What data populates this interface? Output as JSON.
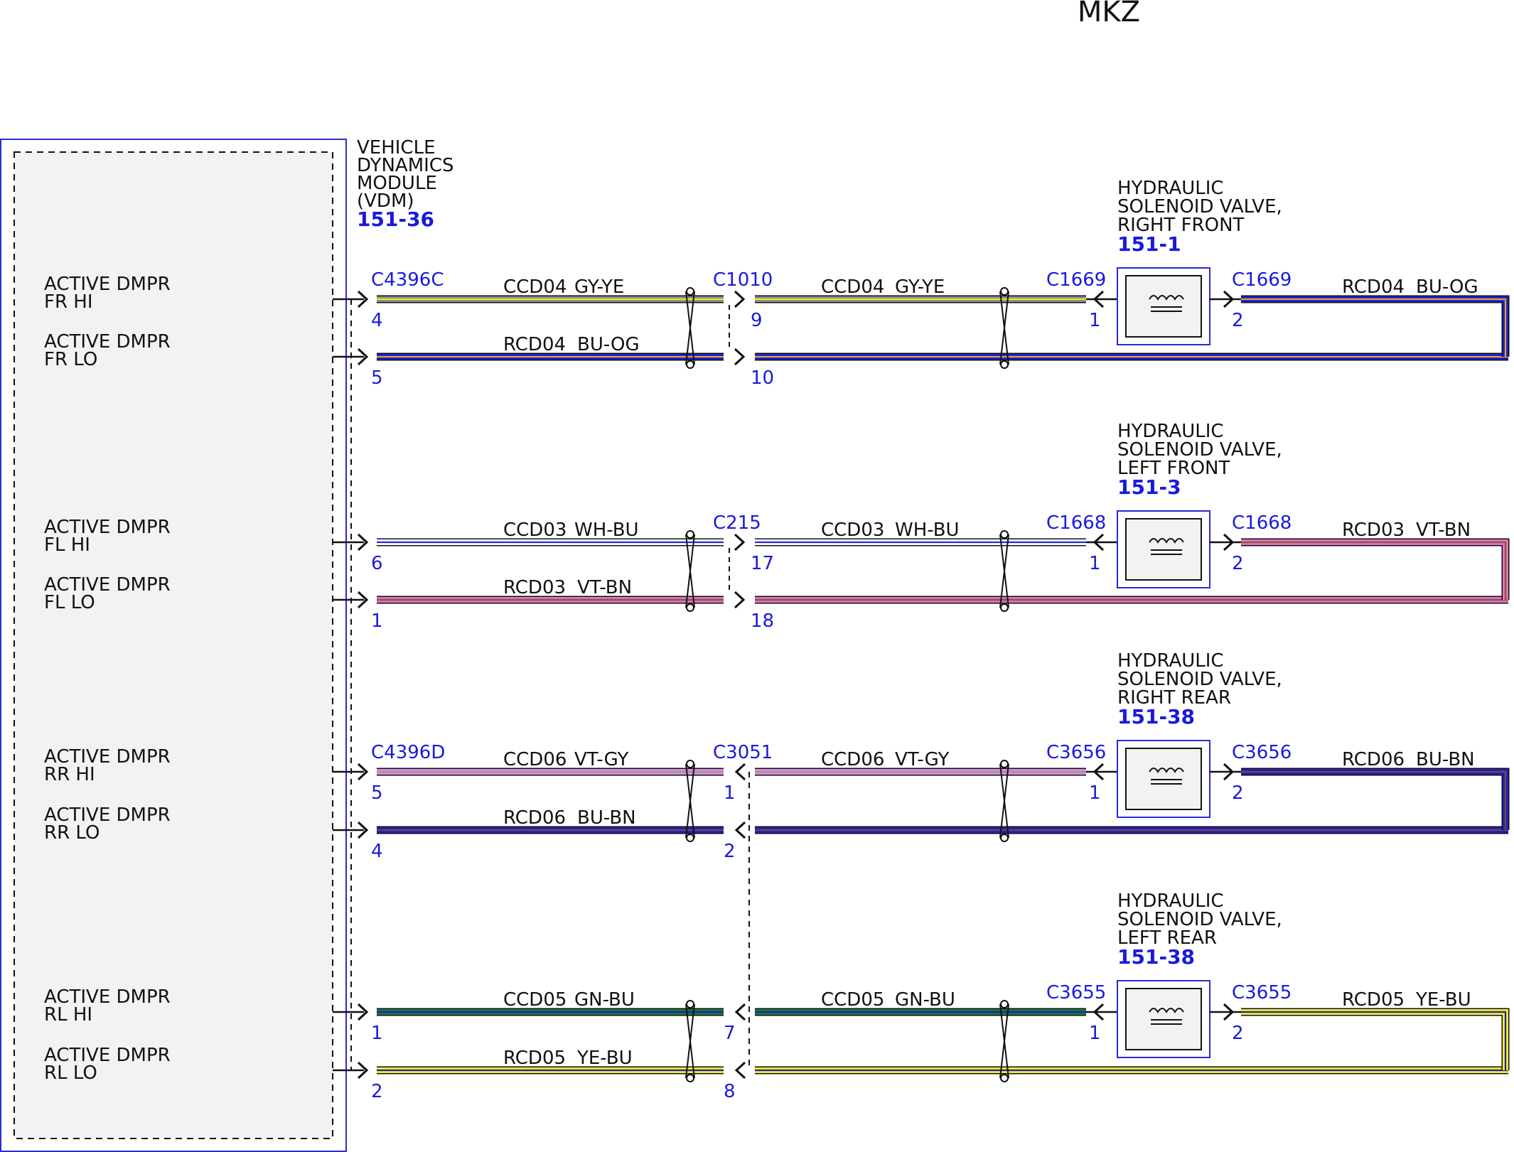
{
  "title": "MKZ",
  "module": {
    "name_lines": [
      "VEHICLE",
      "DYNAMICS",
      "MODULE",
      "(VDM)"
    ],
    "ref": "151-36"
  },
  "circuits": [
    {
      "hi_label": [
        "ACTIVE DMPR",
        "FR HI"
      ],
      "lo_label": [
        "ACTIVE DMPR",
        "FR LO"
      ],
      "vdm_connector": "C4396C",
      "vdm_pin_hi": "4",
      "vdm_pin_lo": "5",
      "inline_connector": "C1010",
      "inline_pin_hi": "9",
      "inline_pin_lo": "10",
      "inline_style": "arrow-right",
      "hi_wire": {
        "name": "CCD04",
        "color_code": "GY-YE",
        "base": "#8c8c8c",
        "stripe": "#e6e62e"
      },
      "lo_wire": {
        "name": "RCD04",
        "color_code": "BU-OG",
        "base": "#1d1dcc",
        "stripe": "#e8a030"
      },
      "valve_name_lines": [
        "HYDRAULIC",
        "SOLENOID VALVE,",
        "RIGHT FRONT"
      ],
      "valve_ref": "151-1",
      "valve_connector": "C1669",
      "valve_pin_1": "1",
      "valve_pin_2": "2"
    },
    {
      "hi_label": [
        "ACTIVE DMPR",
        "FL HI"
      ],
      "lo_label": [
        "ACTIVE DMPR",
        "FL LO"
      ],
      "vdm_connector": "",
      "vdm_pin_hi": "6",
      "vdm_pin_lo": "1",
      "inline_connector": "C215",
      "inline_pin_hi": "17",
      "inline_pin_lo": "18",
      "inline_style": "arrow-right",
      "hi_wire": {
        "name": "CCD03",
        "color_code": "WH-BU",
        "base": "#ffffff",
        "stripe": "#2a2ad8"
      },
      "lo_wire": {
        "name": "RCD03",
        "color_code": "VT-BN",
        "base": "#e070c8",
        "stripe": "#8a5a2b"
      },
      "valve_name_lines": [
        "HYDRAULIC",
        "SOLENOID VALVE,",
        "LEFT FRONT"
      ],
      "valve_ref": "151-3",
      "valve_connector": "C1668",
      "valve_pin_1": "1",
      "valve_pin_2": "2"
    },
    {
      "hi_label": [
        "ACTIVE DMPR",
        "RR HI"
      ],
      "lo_label": [
        "ACTIVE DMPR",
        "RR LO"
      ],
      "vdm_connector": "C4396D",
      "vdm_pin_hi": "5",
      "vdm_pin_lo": "4",
      "inline_connector": "C3051",
      "inline_pin_hi": "1",
      "inline_pin_lo": "2",
      "inline_style": "arrow-left",
      "hi_wire": {
        "name": "CCD06",
        "color_code": "VT-GY",
        "base": "#dd8add",
        "stripe": "#9a9a9a"
      },
      "lo_wire": {
        "name": "RCD06",
        "color_code": "BU-BN",
        "base": "#1d1dcc",
        "stripe": "#7a4a22"
      },
      "valve_name_lines": [
        "HYDRAULIC",
        "SOLENOID VALVE,",
        "RIGHT REAR"
      ],
      "valve_ref": "151-38",
      "valve_connector": "C3656",
      "valve_pin_1": "1",
      "valve_pin_2": "2"
    },
    {
      "hi_label": [
        "ACTIVE DMPR",
        "RL HI"
      ],
      "lo_label": [
        "ACTIVE DMPR",
        "RL LO"
      ],
      "vdm_connector": "",
      "vdm_pin_hi": "1",
      "vdm_pin_lo": "2",
      "inline_connector": "",
      "inline_pin_hi": "7",
      "inline_pin_lo": "8",
      "inline_style": "arrow-left",
      "hi_wire": {
        "name": "CCD05",
        "color_code": "GN-BU",
        "base": "#1a7a32",
        "stripe": "#1d1dcc"
      },
      "lo_wire": {
        "name": "RCD05",
        "color_code": "YE-BU",
        "base": "#f0f020",
        "stripe": "#1d1dcc"
      },
      "valve_name_lines": [
        "HYDRAULIC",
        "SOLENOID VALVE,",
        "LEFT REAR"
      ],
      "valve_ref": "151-38",
      "valve_connector": "C3655",
      "valve_pin_1": "1",
      "valve_pin_2": "2"
    }
  ]
}
